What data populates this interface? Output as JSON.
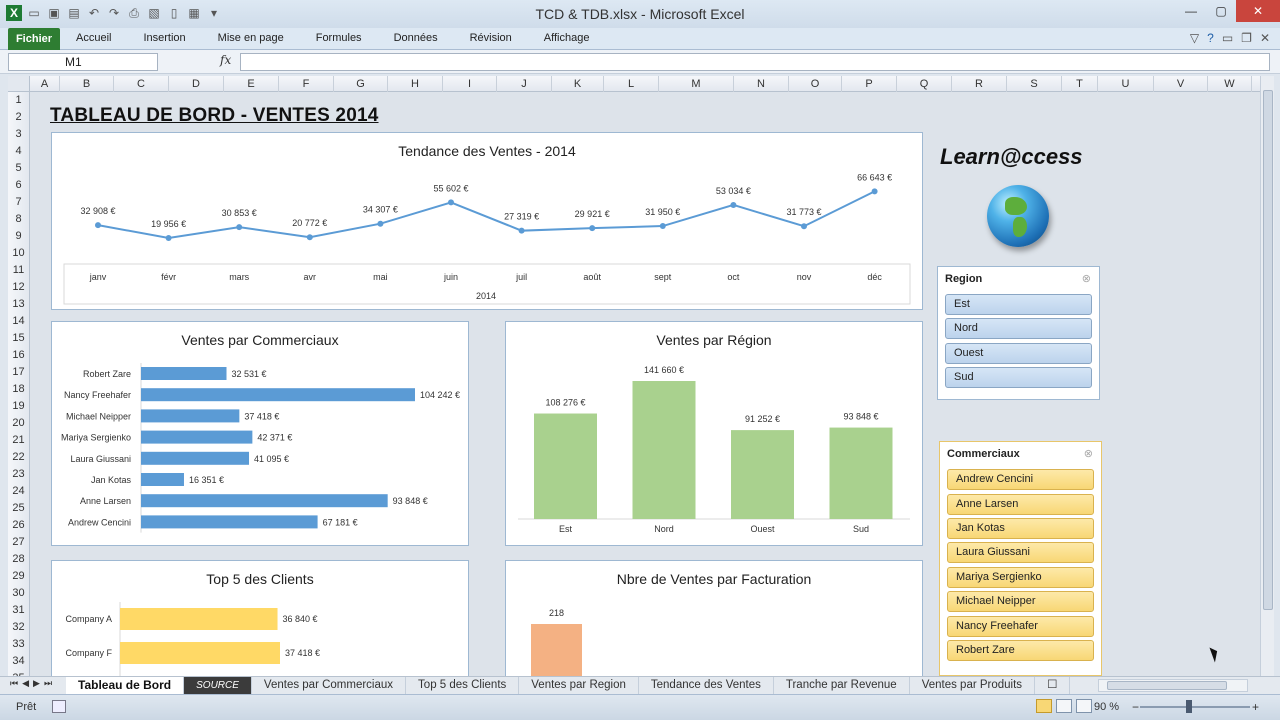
{
  "window": {
    "title": "TCD & TDB.xlsx  -  Microsoft Excel"
  },
  "ribbon": {
    "file_label": "Fichier",
    "tabs": [
      "Accueil",
      "Insertion",
      "Mise en page",
      "Formules",
      "Données",
      "Révision",
      "Affichage"
    ]
  },
  "formula_bar": {
    "name_box": "M1",
    "fx_label": "fx",
    "value": ""
  },
  "columns": [
    "A",
    "B",
    "C",
    "D",
    "E",
    "F",
    "G",
    "H",
    "I",
    "J",
    "K",
    "L",
    "M",
    "N",
    "O",
    "P",
    "Q",
    "R",
    "S",
    "T",
    "U",
    "V",
    "W"
  ],
  "rows": [
    "1",
    "2",
    "3",
    "4",
    "5",
    "6",
    "7",
    "8",
    "9",
    "10",
    "11",
    "12",
    "13",
    "14",
    "15",
    "16",
    "17",
    "18",
    "19",
    "20",
    "21",
    "22",
    "23",
    "24",
    "25",
    "26",
    "27",
    "28",
    "29",
    "30",
    "31",
    "32",
    "33",
    "34",
    "35"
  ],
  "dashboard": {
    "title": "TABLEAU DE BORD - VENTES 2014",
    "logo_text": "Learn@ccess"
  },
  "chart_data": [
    {
      "type": "line",
      "title": "Tendance des Ventes - 2014",
      "xlabel": "2014",
      "categories": [
        "janv",
        "févr",
        "mars",
        "avr",
        "mai",
        "juin",
        "juil",
        "août",
        "sept",
        "oct",
        "nov",
        "déc"
      ],
      "values": [
        32908,
        19956,
        30853,
        20772,
        34307,
        55602,
        27319,
        29921,
        31950,
        53034,
        31773,
        66643
      ],
      "labels": [
        "32 908 €",
        "19 956 €",
        "30 853 €",
        "20 772 €",
        "34 307 €",
        "55 602 €",
        "27 319 €",
        "29 921 €",
        "31 950 €",
        "53 034 €",
        "31 773 €",
        "66 643 €"
      ],
      "color": "#5b9bd5"
    },
    {
      "type": "bar",
      "orientation": "horizontal",
      "title": "Ventes par Commerciaux",
      "categories": [
        "Robert Zare",
        "Nancy Freehafer",
        "Michael Neipper",
        "Mariya Sergienko",
        "Laura Giussani",
        "Jan Kotas",
        "Anne Larsen",
        "Andrew Cencini"
      ],
      "values": [
        32531,
        104242,
        37418,
        42371,
        41095,
        16351,
        93848,
        67181
      ],
      "labels": [
        "32 531 €",
        "104 242 €",
        "37 418 €",
        "42 371 €",
        "41 095 €",
        "16 351 €",
        "93 848 €",
        "67 181 €"
      ],
      "color": "#5b9bd5"
    },
    {
      "type": "bar",
      "title": "Ventes par Région",
      "categories": [
        "Est",
        "Nord",
        "Ouest",
        "Sud"
      ],
      "values": [
        108276,
        141660,
        91252,
        93848
      ],
      "labels": [
        "108 276 €",
        "141 660 €",
        "91 252 €",
        "93 848 €"
      ],
      "color": "#a9d18e"
    },
    {
      "type": "bar",
      "orientation": "horizontal",
      "title": "Top 5 des Clients",
      "categories": [
        "Company A",
        "Company F"
      ],
      "values": [
        36840,
        37418
      ],
      "labels": [
        "36 840 €",
        "37 418 €"
      ],
      "color": "#ffd966"
    },
    {
      "type": "bar",
      "title": "Nbre de Ventes par Facturation",
      "categories": [
        ""
      ],
      "values": [
        218
      ],
      "labels": [
        "218"
      ],
      "color": "#f4b183"
    }
  ],
  "slicers": {
    "region": {
      "title": "Region",
      "items": [
        "Est",
        "Nord",
        "Ouest",
        "Sud"
      ]
    },
    "commerciaux": {
      "title": "Commerciaux",
      "items": [
        "Andrew Cencini",
        "Anne Larsen",
        "Jan Kotas",
        "Laura Giussani",
        "Mariya Sergienko",
        "Michael Neipper",
        "Nancy Freehafer",
        "Robert Zare"
      ]
    }
  },
  "sheet_tabs": [
    "Tableau de Bord",
    "SOURCE",
    "Ventes par Commerciaux",
    "Top 5 des Clients",
    "Ventes par Region",
    "Tendance des Ventes",
    "Tranche par Revenue",
    "Ventes par Produits"
  ],
  "status": {
    "ready": "Prêt",
    "zoom": "90 %",
    "zoom_fraction": 0.4
  }
}
